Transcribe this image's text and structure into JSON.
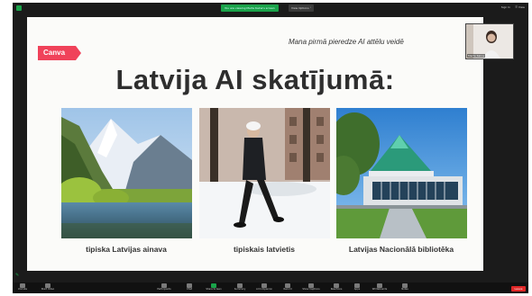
{
  "topbar": {
    "share_text": "You are viewing Marta Kalna's screen",
    "view_options": "View Options ˅",
    "sign_in": "Sign In",
    "menu": "☰ View"
  },
  "slide": {
    "badge": "Canva",
    "subtitle": "Mana pirmā pieredze AI attēlu veidē",
    "title": "Latvija AI skatījumā:",
    "captions": [
      "tipiska Latvijas ainava",
      "tipiskais latvietis",
      "Latvijas Nacionālā bibliotēka"
    ]
  },
  "participant": {
    "name": "Marta Kalna"
  },
  "toolbar": {
    "items": [
      "Unmute",
      "Start Video",
      "Participants",
      "Chat",
      "Share Screen",
      "Summary",
      "AI Companion",
      "Record",
      "Show Captions",
      "Reactions",
      "Apps",
      "Whiteboards",
      "Notes"
    ],
    "end": "Leave"
  },
  "colors": {
    "accent": "#1aa34a",
    "badge": "#f0425a",
    "end": "#e02828"
  }
}
